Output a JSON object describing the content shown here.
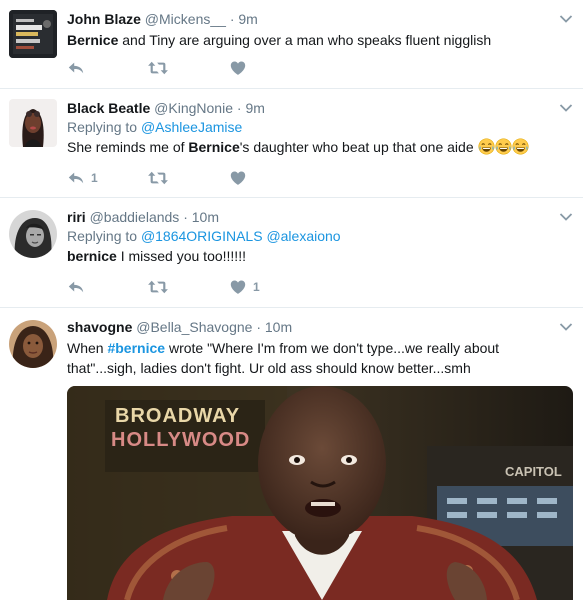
{
  "tweets": [
    {
      "name": "John Blaze",
      "handle": "@Mickens__",
      "time": "9m",
      "keyword": "Bernice",
      "text": " and Tiny are arguing over a man who speaks fluent nigglish",
      "reply_count": "",
      "like_count": ""
    },
    {
      "name": "Black Beatle",
      "handle": "@KingNonie",
      "time": "9m",
      "replying_prefix": "Replying to ",
      "replying_to": "@AshleeJamise",
      "text_before": "She reminds me of ",
      "keyword": "Bernice",
      "text_after": "'s daughter who beat up that one aide ",
      "emoji": [
        "face-with-tears-of-joy",
        "face-with-tears-of-joy",
        "face-with-tears-of-joy"
      ],
      "reply_count": "1",
      "like_count": ""
    },
    {
      "name": "riri",
      "handle": "@baddielands",
      "time": "10m",
      "replying_prefix": "Replying to ",
      "replying_to_1": "@1864ORIGINALS",
      "replying_to_2": "@alexaiono",
      "keyword": "bernice",
      "text": " I missed you too!!!!!!",
      "reply_count": "",
      "like_count": "1"
    },
    {
      "name": "shavogne",
      "handle": "@Bella_Shavogne",
      "time": "10m",
      "text_line1_before": "When ",
      "hashtag": "#bernice",
      "text_line1_after": " wrote \"Where I'm from we don't type...we really about",
      "text_line2": "that\"...sigh, ladies don't fight.  Ur old ass should know better...smh",
      "media": {
        "sign_top": "BROADWAY",
        "sign_bottom": "HOLLYWOOD",
        "sign_right": "CAPITOL"
      }
    }
  ],
  "dot": "·",
  "colors": {
    "link": "#1b95e0",
    "muted": "#657786",
    "icon": "#8899a6",
    "divider": "#e6ecf0"
  },
  "icons": {
    "reply": "reply-icon",
    "retweet": "retweet-icon",
    "like": "heart-icon",
    "menu": "chevron-down-icon"
  }
}
